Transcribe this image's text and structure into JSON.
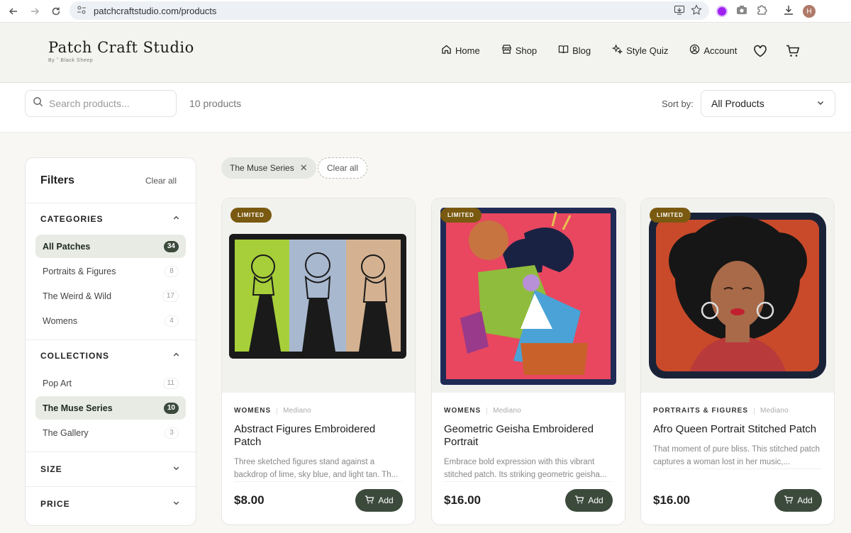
{
  "browser": {
    "url": "patchcraftstudio.com/products",
    "avatar_initial": "H"
  },
  "header": {
    "logo_title": "Patch Craft Studio",
    "logo_subtitle": "By ˜ Black Sheep",
    "nav": [
      {
        "label": "Home",
        "icon": "home-icon"
      },
      {
        "label": "Shop",
        "icon": "store-icon"
      },
      {
        "label": "Blog",
        "icon": "book-icon"
      },
      {
        "label": "Style Quiz",
        "icon": "sparkles-icon"
      },
      {
        "label": "Account",
        "icon": "user-circle-icon"
      }
    ]
  },
  "toolbar": {
    "search_placeholder": "Search products...",
    "product_count": "10 products",
    "sort_label": "Sort by:",
    "sort_value": "All Products"
  },
  "filters": {
    "title": "Filters",
    "clear_all": "Clear all",
    "categories": {
      "title": "CATEGORIES",
      "items": [
        {
          "label": "All Patches",
          "count": "34",
          "active": true
        },
        {
          "label": "Portraits & Figures",
          "count": "8",
          "active": false
        },
        {
          "label": "The Weird & Wild",
          "count": "17",
          "active": false
        },
        {
          "label": "Womens",
          "count": "4",
          "active": false
        }
      ]
    },
    "collections": {
      "title": "COLLECTIONS",
      "items": [
        {
          "label": "Pop Art",
          "count": "11",
          "active": false
        },
        {
          "label": "The Muse Series",
          "count": "10",
          "active": true
        },
        {
          "label": "The Gallery",
          "count": "3",
          "active": false
        }
      ]
    },
    "size": {
      "title": "SIZE"
    },
    "price": {
      "title": "PRICE"
    }
  },
  "active_filters": {
    "chip_label": "The Muse Series",
    "clear_label": "Clear all"
  },
  "products": [
    {
      "badge": "LIMITED",
      "category": "WOMENS",
      "brand": "Mediano",
      "name": "Abstract Figures Embroidered Patch",
      "description": "Three sketched figures stand against a backdrop of lime, sky blue, and light tan. Th...",
      "price": "$8.00",
      "add_label": "Add"
    },
    {
      "badge": "LIMITED",
      "category": "WOMENS",
      "brand": "Mediano",
      "name": "Geometric Geisha Embroidered Portrait",
      "description": "Embrace bold expression with this vibrant stitched patch. Its striking geometric geisha...",
      "price": "$16.00",
      "add_label": "Add"
    },
    {
      "badge": "LIMITED",
      "category": "PORTRAITS & FIGURES",
      "brand": "Mediano",
      "name": "Afro Queen Portrait Stitched Patch",
      "description": "That moment of pure bliss. This stitched patch captures a woman lost in her music,...",
      "price": "$16.00",
      "add_label": "Add"
    }
  ]
}
